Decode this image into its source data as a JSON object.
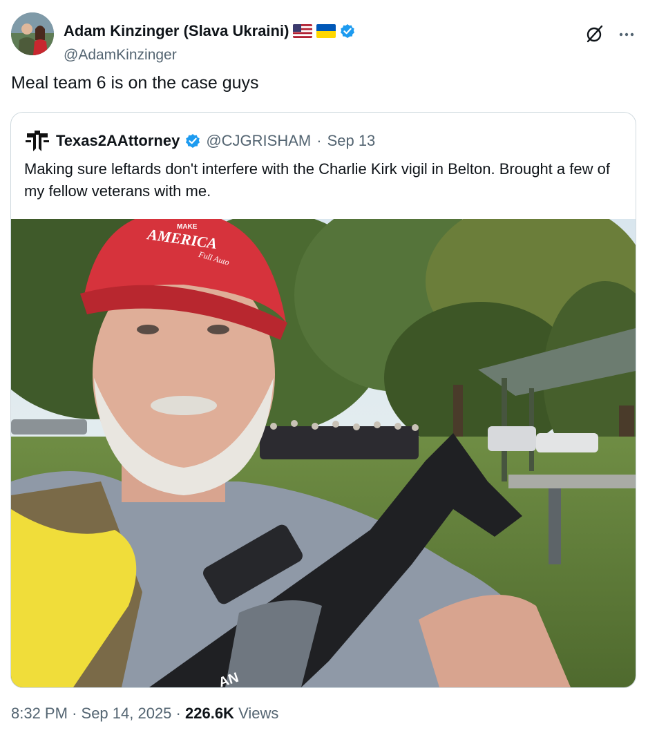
{
  "tweet": {
    "author": {
      "display_name": "Adam Kinzinger (Slava Ukraini)",
      "handle": "@AdamKinzinger",
      "flags": [
        "us-flag-icon",
        "ukraine-flag-icon"
      ],
      "verified": true
    },
    "text": "Meal team 6 is on the case guys",
    "quoted": {
      "display_name": "Texas2AAttorney",
      "handle": "@CJGRISHAM",
      "separator": "·",
      "date": "Sep 13",
      "text": "Making sure leftards don't interfere with the Charlie Kirk vigil in Belton. Brought a few of my fellow veterans with me.",
      "photo": {
        "hat_text_top": "MAKE",
        "hat_text_main": "AMERICA",
        "hat_text_bottom": "Full Auto",
        "patch_text": "AN"
      }
    },
    "meta": {
      "time": "8:32 PM",
      "sep1": "·",
      "date": "Sep 14, 2025",
      "sep2": "·",
      "views_count": "226.6K",
      "views_label": "Views"
    }
  },
  "colors": {
    "verified_blue": "#1d9bf0",
    "text_primary": "#0f1419",
    "text_secondary": "#536471",
    "border": "#cfd9de"
  }
}
